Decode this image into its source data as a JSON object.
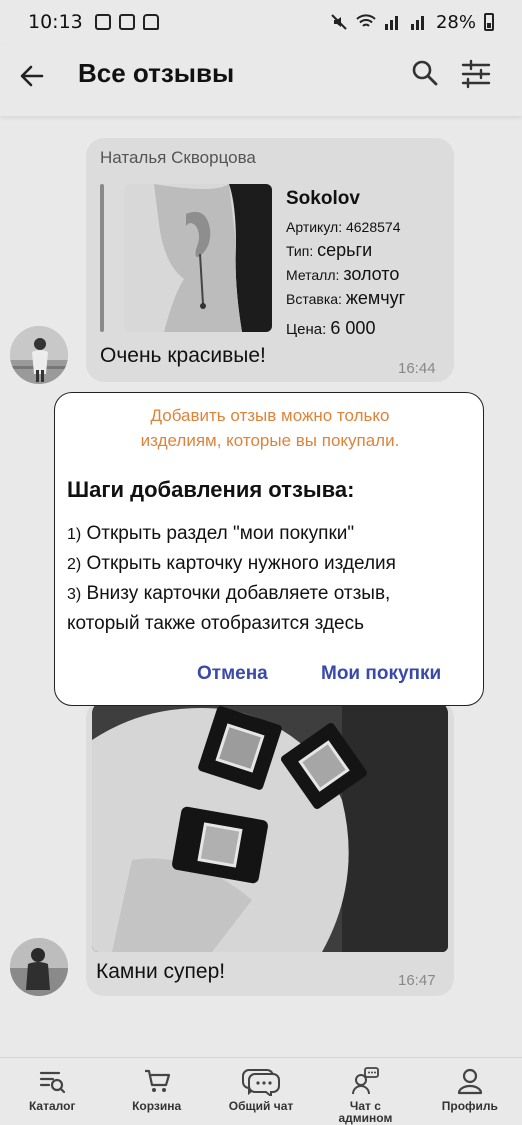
{
  "status_bar": {
    "time": "10:13",
    "battery": "28%"
  },
  "header": {
    "title": "Все отзывы",
    "icons": [
      "back-arrow-icon",
      "search-icon",
      "filter-icon"
    ]
  },
  "messages": [
    {
      "author": "Наталья Скворцова",
      "product": {
        "brand": "Sokolov",
        "article_label": "Артикул:",
        "article": "4628574",
        "type_label": "Тип:",
        "type": "серьги",
        "metal_label": "Металл:",
        "metal": "золото",
        "insert_label": "Вставка:",
        "insert": "жемчуг",
        "price_label": "Цена:",
        "price": "6 000"
      },
      "text": "Очень красивые!",
      "time": "16:44"
    },
    {
      "text": "Камни супер!",
      "time": "16:47"
    }
  ],
  "modal": {
    "notice_line1": "Добавить отзыв можно только",
    "notice_line2": "изделиям, которые вы покупали.",
    "title": "Шаги добавления отзыва:",
    "step1_num": "1)",
    "step1": "Открыть раздел \"мои покупки\"",
    "step2_num": "2)",
    "step2": "Открыть карточку нужного изделия",
    "step3_num": "3)",
    "step3_line1": "Внизу карточки добавляете отзыв,",
    "step3_line2": "который также отобразится здесь",
    "cancel": "Отмена",
    "my_purchases": "Мои покупки",
    "notice_color": "#e0833a",
    "action_color": "#3a4aa8"
  },
  "bottom_nav": [
    {
      "label": "Каталог",
      "icon": "catalog-icon"
    },
    {
      "label": "Корзина",
      "icon": "cart-icon"
    },
    {
      "label": "Общий чат",
      "icon": "chat-icon"
    },
    {
      "label": "Чат с",
      "label2": "админом",
      "icon": "admin-chat-icon"
    },
    {
      "label": "Профиль",
      "icon": "profile-icon"
    }
  ]
}
